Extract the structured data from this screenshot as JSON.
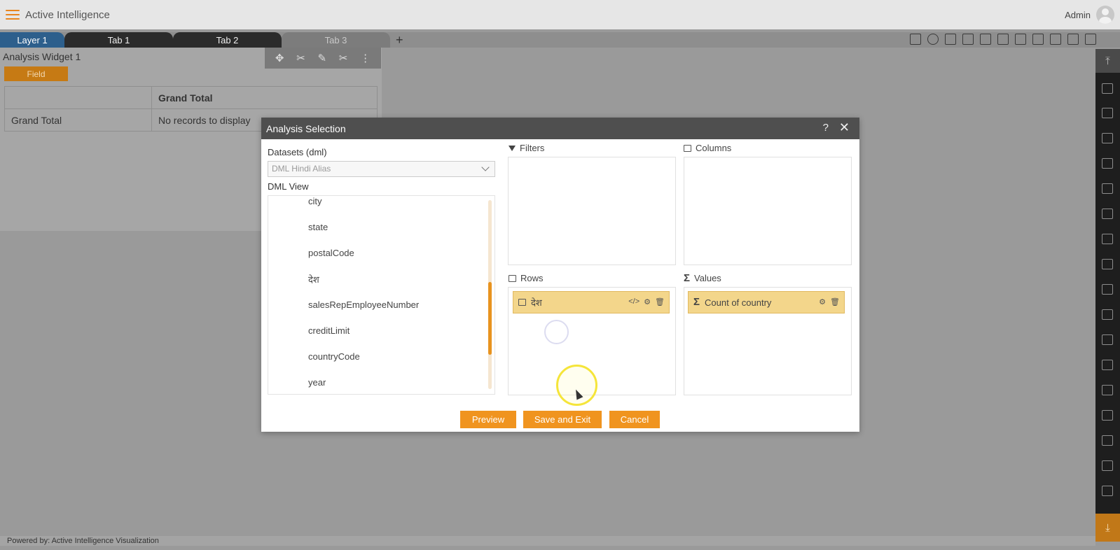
{
  "app": {
    "title": "Active Intelligence",
    "user": "Admin"
  },
  "tabs": [
    {
      "label": "Layer 1"
    },
    {
      "label": "Tab 1"
    },
    {
      "label": "Tab 2"
    },
    {
      "label": "Tab 3"
    }
  ],
  "tab_add": "+",
  "widget": {
    "title": "Analysis Widget 1",
    "field_chip": "Field",
    "table": {
      "header": "Grand Total",
      "row_label": "Grand Total",
      "row_value": "No records to display"
    }
  },
  "dialog": {
    "title": "Analysis Selection",
    "help": "?",
    "close": "✕",
    "datasets_label": "Datasets (dml)",
    "dataset_selected": "DML Hindi Alias",
    "view_label": "DML View",
    "fields": [
      "city",
      "state",
      "postalCode",
      "देश",
      "salesRepEmployeeNumber",
      "creditLimit",
      "countryCode",
      "year"
    ],
    "filters_label": "Filters",
    "columns_label": "Columns",
    "rows_label": "Rows",
    "values_label": "Values",
    "row_chip": "देश",
    "value_chip": "Count of country",
    "buttons": {
      "preview": "Preview",
      "save": "Save and Exit",
      "cancel": "Cancel"
    }
  },
  "footer": "Powered by: Active Intelligence Visualization",
  "colors": {
    "accent": "#f0941f",
    "chip": "#f3d68b",
    "active_tab": "#2d5f8c",
    "header": "#4f4f4f"
  }
}
